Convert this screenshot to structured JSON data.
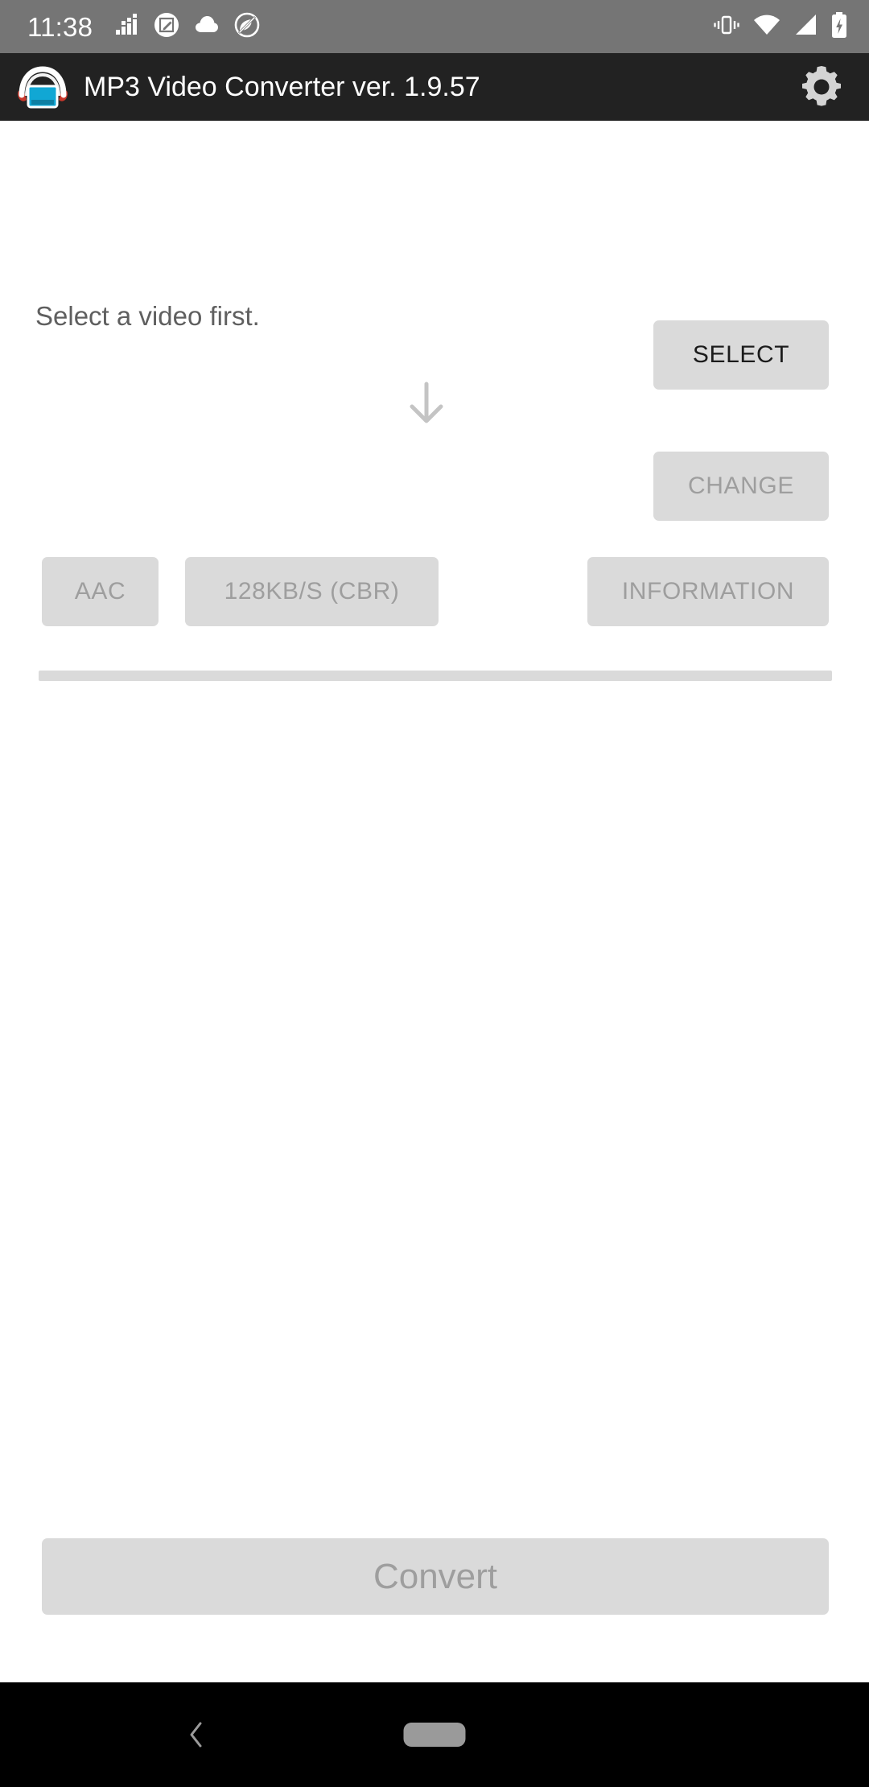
{
  "status_bar": {
    "time": "11:38",
    "left_icons": [
      {
        "name": "equalizer-icon",
        "label": "equalizer"
      },
      {
        "name": "screenshot-edit-icon",
        "label": "screenshot editor"
      },
      {
        "name": "cloud-icon",
        "label": "cloud sync"
      },
      {
        "name": "do-not-disturb-icon",
        "label": "do not disturb"
      }
    ],
    "right_icons": [
      {
        "name": "vibrate-icon",
        "label": "vibrate"
      },
      {
        "name": "wifi-icon",
        "label": "wifi full"
      },
      {
        "name": "cellular-signal-icon",
        "label": "cellular signal"
      },
      {
        "name": "battery-charging-icon",
        "label": "battery charging"
      }
    ],
    "background_color": "#757575",
    "foreground_color": "#ffffff"
  },
  "app_bar": {
    "title": "MP3 Video Converter ver. 1.9.57",
    "icon_name": "headphones-video-app-icon",
    "settings_icon_name": "gear-icon",
    "background_color": "#222222",
    "title_color": "#ffffff"
  },
  "main": {
    "status_message": "Select a video first.",
    "arrow_icon_name": "arrow-down-icon",
    "buttons": {
      "select": {
        "label": "SELECT",
        "enabled": true
      },
      "change": {
        "label": "CHANGE",
        "enabled": false
      },
      "format": {
        "label": "AAC",
        "enabled": false
      },
      "bitrate": {
        "label": "128KB/S (CBR)",
        "enabled": false
      },
      "information": {
        "label": "INFORMATION",
        "enabled": false
      },
      "convert": {
        "label": "Convert",
        "enabled": false
      }
    },
    "progress_bar": {
      "value": 0,
      "color": "#dadada"
    },
    "button_fill_color": "#dadada",
    "enabled_text_color": "#1b1b1b",
    "disabled_text_color": "#9e9e9e"
  },
  "nav_bar": {
    "back_icon_name": "chevron-left-icon",
    "home_icon_name": "home-pill-icon",
    "background_color": "#000000"
  }
}
